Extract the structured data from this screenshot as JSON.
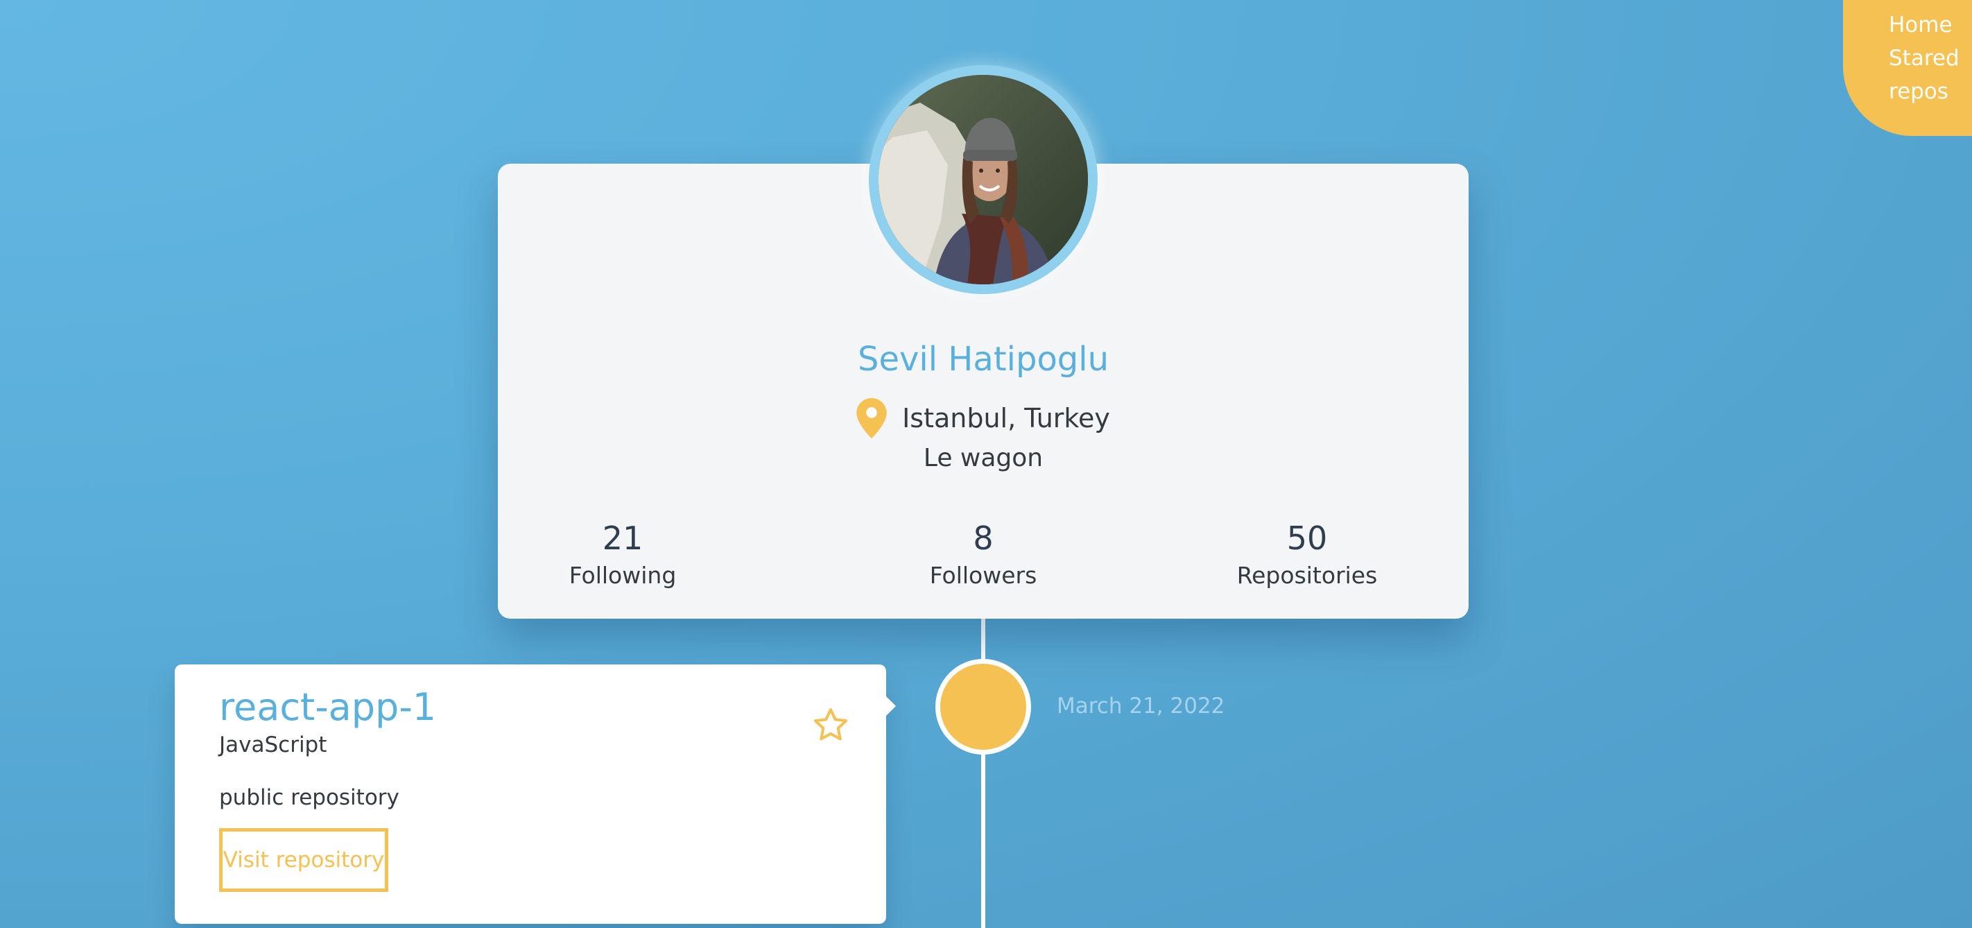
{
  "nav": {
    "home_label": "Home",
    "stared_line1": "Stared",
    "stared_line2": "repos"
  },
  "profile": {
    "avatar_icon": "user-photo-avatar",
    "name": "Sevil Hatipoglu",
    "location_icon": "map-pin-icon",
    "location": "Istanbul, Turkey",
    "company": "Le wagon",
    "stats": {
      "following": {
        "value": "21",
        "label": "Following"
      },
      "followers": {
        "value": "8",
        "label": "Followers"
      },
      "repositories": {
        "value": "50",
        "label": "Repositories"
      }
    }
  },
  "timeline": {
    "date": "March 21, 2022"
  },
  "repo": {
    "name": "react-app-1",
    "language": "JavaScript",
    "visibility": "public repository",
    "button_label": "Visit repository",
    "star_icon": "star-outline-icon"
  },
  "colors": {
    "accent_yellow": "#f4c152",
    "accent_blue": "#5ab0dc",
    "background": "#5aaed9",
    "card": "#f3f5f7"
  }
}
